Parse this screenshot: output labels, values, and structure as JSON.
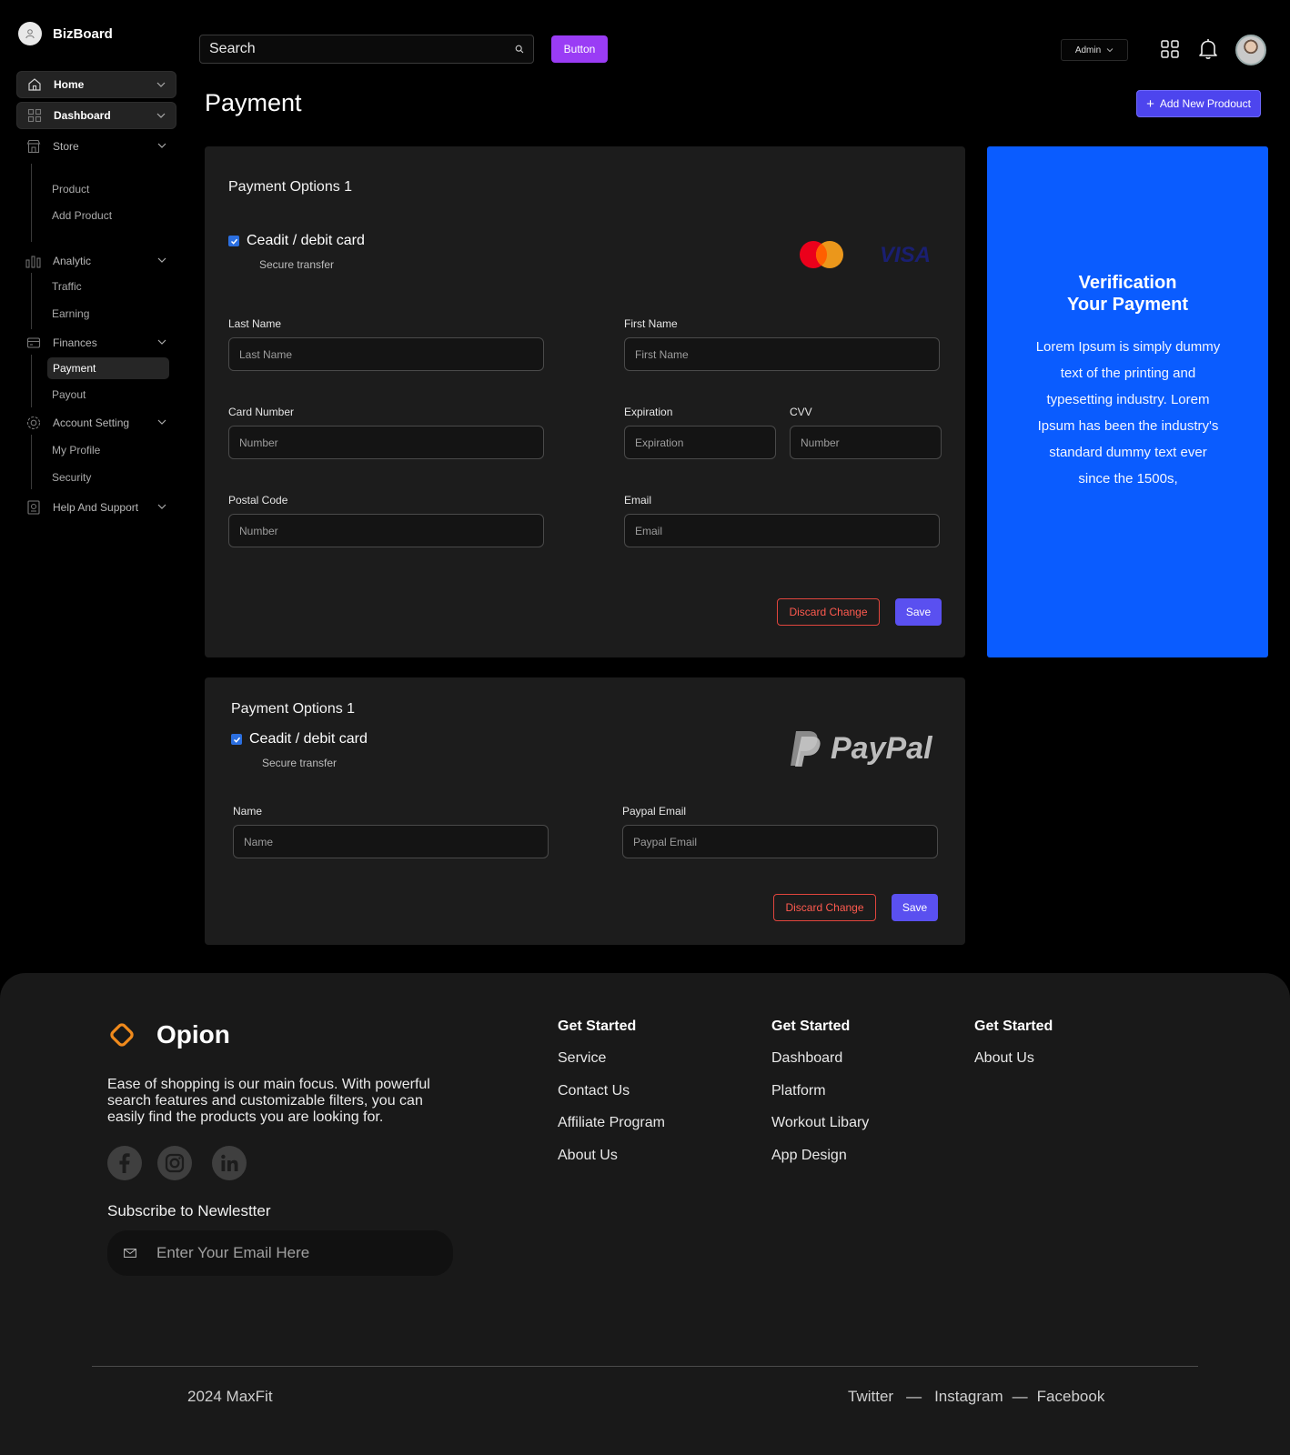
{
  "app": {
    "name": "BizBoard"
  },
  "sidebar": {
    "items": [
      {
        "label": "Home"
      },
      {
        "label": "Dashboard"
      },
      {
        "label": "Store",
        "children": [
          "Product",
          "Add Product"
        ]
      },
      {
        "label": "Analytic",
        "children": [
          "Traffic",
          "Earning"
        ]
      },
      {
        "label": "Finances",
        "children": [
          "Payment",
          "Payout"
        ]
      },
      {
        "label": "Account Setting",
        "children": [
          "My Profile",
          "Security"
        ]
      },
      {
        "label": "Help And Support"
      }
    ],
    "selected_child": "Payment"
  },
  "topbar": {
    "search_placeholder": "Search",
    "button_label": "Button",
    "admin_label": "Admin"
  },
  "page": {
    "title": "Payment",
    "add_button": "Add New Prodouct"
  },
  "card_payment": {
    "title": "Payment Options 1",
    "option_label": "Ceadit / debit card",
    "option_sub": "Secure transfer",
    "visa_text": "VISA",
    "fields": {
      "last_name_label": "Last Name",
      "last_name_placeholder": "Last Name",
      "first_name_label": "First Name",
      "first_name_placeholder": "First Name",
      "card_number_label": "Card Number",
      "card_number_placeholder": "Number",
      "expiration_label": "Expiration",
      "expiration_placeholder": "Expiration",
      "cvv_label": "CVV",
      "cvv_placeholder": "Number",
      "postal_label": "Postal Code",
      "postal_placeholder": "Number",
      "email_label": "Email",
      "email_placeholder": "Email"
    },
    "discard_label": "Discard Change",
    "save_label": "Save"
  },
  "card_paypal": {
    "title": "Payment Options 1",
    "option_label": "Ceadit / debit card",
    "option_sub": "Secure transfer",
    "paypal_text": "PayPal",
    "fields": {
      "name_label": "Name",
      "name_placeholder": "Name",
      "paypal_email_label": "Paypal Email",
      "paypal_email_placeholder": "Paypal Email"
    },
    "discard_label": "Discard Change",
    "save_label": "Save"
  },
  "verify": {
    "title": "Verification\nYour Payment",
    "text": "Lorem Ipsum is simply dummy text of the printing and typesetting industry. Lorem Ipsum has been the industry's standard dummy text ever since the 1500s,"
  },
  "footer": {
    "brand": "Opion",
    "description": "Ease of shopping is our main focus. With powerful search features and customizable filters, you can easily find the products you are looking for.",
    "subscribe_title": "Subscribe to Newlestter",
    "email_placeholder": "Enter Your Email Here",
    "columns": [
      {
        "head": "Get Started",
        "links": [
          "Service",
          "Contact Us",
          "Affiliate Program",
          "About Us"
        ]
      },
      {
        "head": "Get Started",
        "links": [
          "Dashboard",
          "Platform",
          "Workout Libary",
          "App Design"
        ]
      },
      {
        "head": "Get Started",
        "links": [
          "About Us"
        ]
      }
    ],
    "copyright": "2024 MaxFit",
    "social_links": [
      "Twitter",
      "—",
      "Instagram",
      "—",
      "Facebook"
    ]
  },
  "colors": {
    "accent_purple": "#9a3cf5",
    "primary_button": "#4d45ee",
    "verify_blue": "#0a5cff",
    "danger": "#e0453d",
    "footer_logo": "#f08a1c"
  }
}
